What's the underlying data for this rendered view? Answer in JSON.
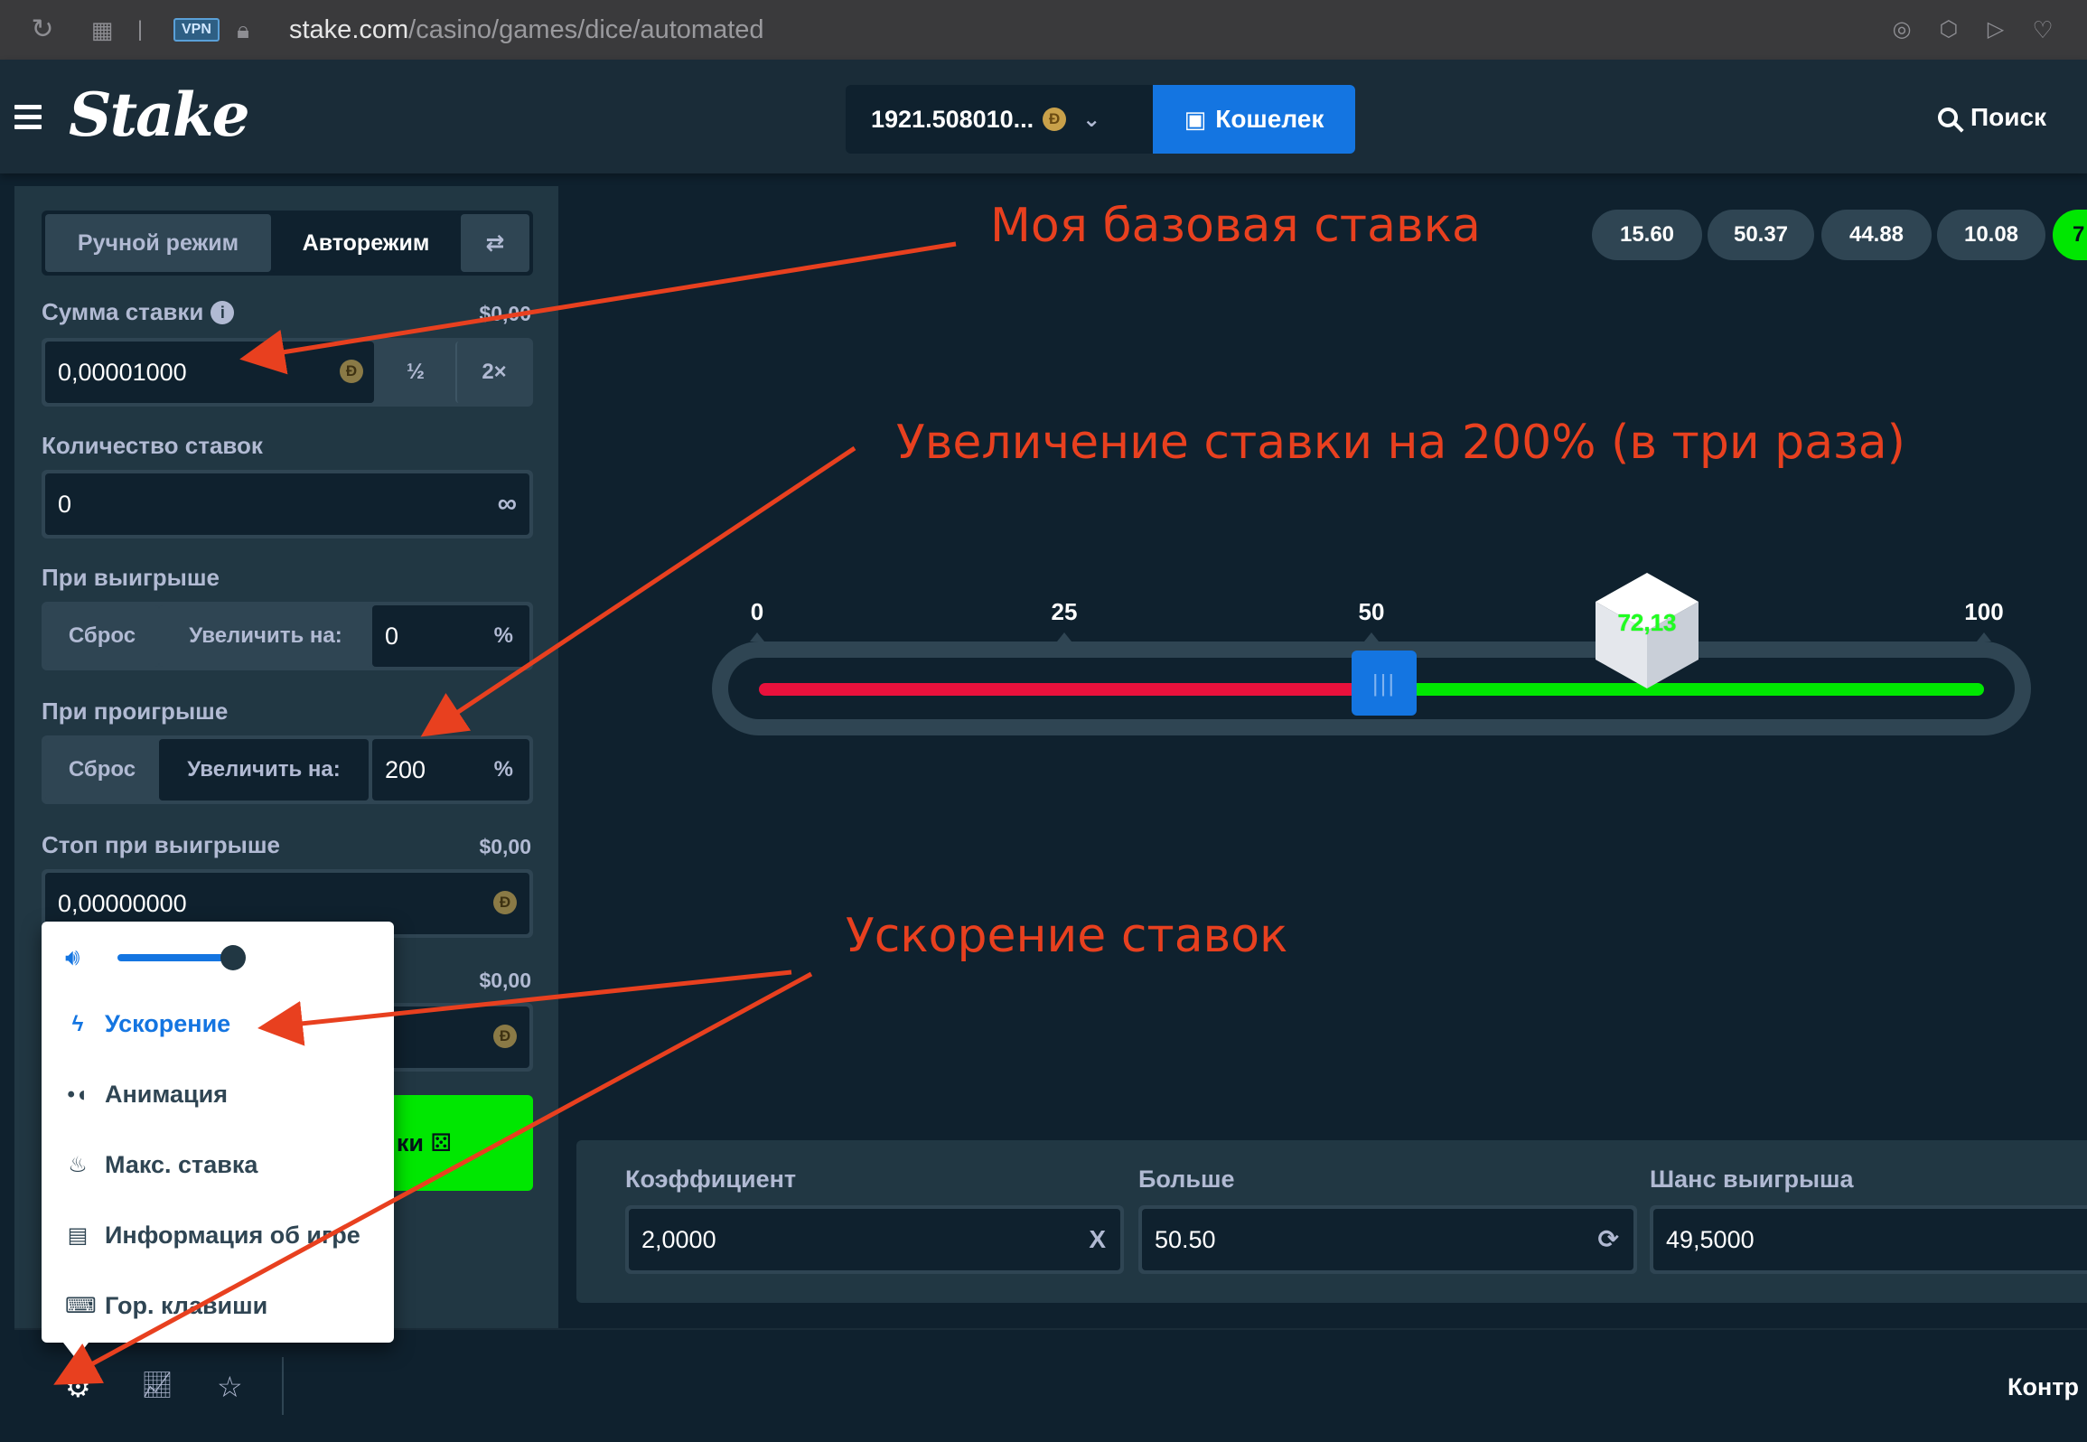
{
  "browser": {
    "vpn_label": "VPN",
    "url_domain": "stake.com",
    "url_path": "/casino/games/dice/automated"
  },
  "header": {
    "logo": "Stake",
    "balance": "1921.508010...",
    "currency_symbol": "Đ",
    "wallet_label": "Кошелек",
    "search_label": "Поиск"
  },
  "bet_panel": {
    "tabs": {
      "manual": "Ручной режим",
      "auto": "Авторежим"
    },
    "bet_amount": {
      "label": "Сумма ставки",
      "usd": "$0,00",
      "value": "0,00001000",
      "half": "½",
      "double": "2×"
    },
    "num_bets": {
      "label": "Количество ставок",
      "value": "0"
    },
    "on_win": {
      "label": "При выигрыше",
      "reset": "Сброс",
      "increase": "Увеличить на:",
      "value": "0",
      "unit": "%"
    },
    "on_loss": {
      "label": "При проигрыше",
      "reset": "Сброс",
      "increase": "Увеличить на:",
      "value": "200",
      "unit": "%"
    },
    "stop_profit": {
      "label": "Стоп при выигрыше",
      "usd": "$0,00",
      "value": "0,00000000"
    },
    "stop_loss": {
      "usd": "$0,00"
    },
    "start_button": "ки"
  },
  "settings_menu": {
    "items": [
      {
        "label": "Ускорение",
        "active": true
      },
      {
        "label": "Анимация"
      },
      {
        "label": "Макс. ставка"
      },
      {
        "label": "Информация об игре"
      },
      {
        "label": "Гор. клавиши"
      }
    ],
    "volume": 0.8
  },
  "bottom_bar": {
    "controls_label": "Контр"
  },
  "game": {
    "history": [
      "15.60",
      "50.37",
      "44.88",
      "10.08",
      "7"
    ],
    "ticks": [
      "0",
      "25",
      "50",
      "100"
    ],
    "roll_over": 50.5,
    "result": "72,13",
    "stats": {
      "multiplier": {
        "label": "Коэффициент",
        "value": "2,0000",
        "suffix": "X"
      },
      "roll_over": {
        "label": "Больше",
        "value": "50.50"
      },
      "win_chance": {
        "label": "Шанс выигрыша",
        "value": "49,5000"
      }
    }
  },
  "annotations": {
    "base_bet": "Моя базовая ставка",
    "increase": "Увеличение ставки на 200% (в три раза)",
    "speed": "Ускорение ставок"
  },
  "colors": {
    "accent_blue": "#1475e1",
    "win_green": "#00e701",
    "lose_red": "#e9113c",
    "annotation_red": "#e8401f"
  }
}
